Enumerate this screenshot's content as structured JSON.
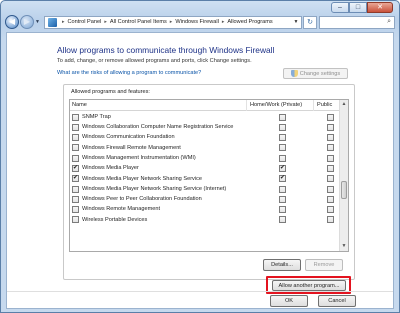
{
  "window": {
    "caption_buttons": {
      "minimize": "–",
      "maximize": "□",
      "close": "✕"
    }
  },
  "nav": {
    "back_glyph": "◀",
    "forward_glyph": "▶",
    "history_glyph": "▼",
    "breadcrumbs": [
      "Control Panel",
      "All Control Panel Items",
      "Windows Firewall",
      "Allowed Programs"
    ],
    "breadcrumb_separator": "▸",
    "address_dropdown_glyph": "▼",
    "refresh_glyph": "↻",
    "search_glyph": "⌕",
    "icons": [
      "control-panel-icon",
      "refresh-icon",
      "search-icon"
    ]
  },
  "page": {
    "heading": "Allow programs to communicate through Windows Firewall",
    "subtext": "To add, change, or remove allowed programs and ports, click Change settings.",
    "risk_link": "What are the risks of allowing a program to communicate?",
    "change_settings_label": "Change settings"
  },
  "allowed": {
    "group_label": "Allowed programs and features:",
    "columns": {
      "name": "Name",
      "home_work": "Home/Work (Private)",
      "public": "Public"
    },
    "check_glyph": "✔",
    "rows": [
      {
        "name": "SNMP Trap",
        "enabled": false,
        "home": false,
        "public": false
      },
      {
        "name": "Windows Collaboration Computer Name Registration Service",
        "enabled": false,
        "home": false,
        "public": false
      },
      {
        "name": "Windows Communication Foundation",
        "enabled": false,
        "home": false,
        "public": false
      },
      {
        "name": "Windows Firewall Remote Management",
        "enabled": false,
        "home": false,
        "public": false
      },
      {
        "name": "Windows Management Instrumentation (WMI)",
        "enabled": false,
        "home": false,
        "public": false
      },
      {
        "name": "Windows Media Player",
        "enabled": true,
        "home": true,
        "public": false
      },
      {
        "name": "Windows Media Player Network Sharing Service",
        "enabled": true,
        "home": true,
        "public": false
      },
      {
        "name": "Windows Media Player Network Sharing Service (Internet)",
        "enabled": false,
        "home": false,
        "public": false
      },
      {
        "name": "Windows Peer to Peer Collaboration Foundation",
        "enabled": false,
        "home": false,
        "public": false
      },
      {
        "name": "Windows Remote Management",
        "enabled": false,
        "home": false,
        "public": false
      },
      {
        "name": "Wireless Portable Devices",
        "enabled": false,
        "home": false,
        "public": false
      }
    ],
    "scroll_up_glyph": "▲",
    "scroll_down_glyph": "▼",
    "details_label": "Details...",
    "remove_label": "Remove",
    "allow_another_label": "Allow another program..."
  },
  "footer": {
    "ok_label": "OK",
    "cancel_label": "Cancel"
  },
  "colors": {
    "heading": "#1e3287",
    "link": "#0a54a8",
    "highlight": "#e3131f"
  }
}
